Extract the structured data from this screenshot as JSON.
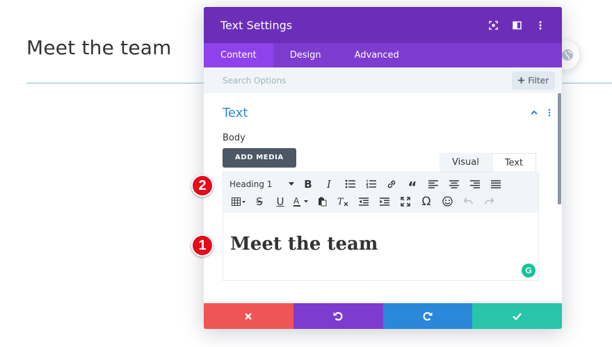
{
  "background": {
    "heading": "Meet the team"
  },
  "modal": {
    "title": "Text Settings",
    "tabs": [
      {
        "label": "Content",
        "active": true
      },
      {
        "label": "Design",
        "active": false
      },
      {
        "label": "Advanced",
        "active": false
      }
    ],
    "search": {
      "placeholder": "Search Options",
      "filter_label": "Filter"
    },
    "section": {
      "title": "Text",
      "body_label": "Body"
    },
    "add_media_label": "ADD MEDIA",
    "editor_tabs": [
      {
        "label": "Visual",
        "active": false
      },
      {
        "label": "Text",
        "active": true
      }
    ],
    "toolbar": {
      "format_select": "Heading 1",
      "row1_icons": [
        "bold-icon",
        "italic-icon",
        "bullet-list-icon",
        "numbered-list-icon",
        "link-icon",
        "blockquote-icon",
        "align-left-icon",
        "align-center-icon",
        "align-right-icon",
        "align-justify-icon"
      ],
      "row2_icons": [
        "table-icon",
        "strikethrough-icon",
        "underline-icon",
        "text-color-icon",
        "paste-text-icon",
        "clear-formatting-icon",
        "outdent-icon",
        "indent-icon",
        "fullscreen-icon",
        "special-character-icon",
        "emoji-icon",
        "undo-icon",
        "redo-icon"
      ]
    },
    "editor_content": "Meet the team",
    "grammarly_label": "G",
    "footer": {
      "colors": {
        "cancel": "#ef5555",
        "undo": "#7d3bcf",
        "redo": "#2b87da",
        "save": "#29c4a9"
      }
    }
  },
  "annotations": [
    {
      "number": "1"
    },
    {
      "number": "2"
    }
  ],
  "colors": {
    "header": "#6c2eb9",
    "tabs_bar": "#7e3bd0",
    "active_tab": "#8f42ec",
    "accent_blue": "#2b87da"
  }
}
